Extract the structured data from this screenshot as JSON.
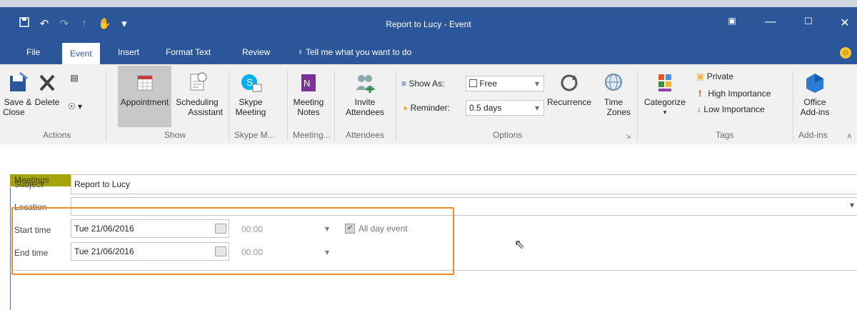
{
  "window": {
    "title": "Report to Lucy - Event",
    "controls": [
      "ribbon-display-icon",
      "minimize-icon",
      "maximize-icon",
      "close-icon"
    ]
  },
  "quick_access": {
    "icons": [
      "save-icon",
      "undo-icon",
      "redo-icon",
      "forward-icon",
      "touch-mode-icon",
      "customize-icon"
    ]
  },
  "tabs": [
    "File",
    "Event",
    "Insert",
    "Format Text",
    "Review"
  ],
  "active_tab": "Event",
  "tell_me": "Tell me what you want to do",
  "ribbon": {
    "actions": {
      "save_close": [
        "Save &",
        "Close"
      ],
      "delete": "Delete",
      "label": "Actions"
    },
    "show": {
      "appointment": "Appointment",
      "scheduling": [
        "Scheduling",
        "Assistant"
      ],
      "label": "Show"
    },
    "skype": {
      "button": [
        "Skype",
        "Meeting"
      ],
      "label": "Skype M..."
    },
    "meeting_notes": {
      "button": [
        "Meeting",
        "Notes"
      ],
      "label": "Meeting..."
    },
    "attendees": {
      "button": [
        "Invite",
        "Attendees"
      ],
      "label": "Attendees"
    },
    "options": {
      "show_as_label": "Show As:",
      "show_as_value": "Free",
      "reminder_label": "Reminder:",
      "reminder_value": "0.5 days",
      "recurrence": "Recurrence",
      "time_zones": [
        "Time",
        "Zones"
      ],
      "label": "Options"
    },
    "tags": {
      "categorize": "Categorize",
      "private": "Private",
      "high": "High Importance",
      "low": "Low Importance",
      "label": "Tags"
    },
    "addins": {
      "button": [
        "Office",
        "Add-ins"
      ],
      "label": "Add-ins"
    }
  },
  "form": {
    "section": "Meetings",
    "subject_label": "Subject",
    "subject_value": "Report to Lucy",
    "location_label": "Location",
    "start_label": "Start time",
    "start_date": "Tue 21/06/2016",
    "start_time": "00:00",
    "end_label": "End time",
    "end_date": "Tue 21/06/2016",
    "end_time": "00:00",
    "all_day_label": "All day event",
    "all_day_checked": true
  },
  "colors": {
    "brand": "#2b579a",
    "section_band": "#a5a40f",
    "highlight": "#f0892b"
  }
}
